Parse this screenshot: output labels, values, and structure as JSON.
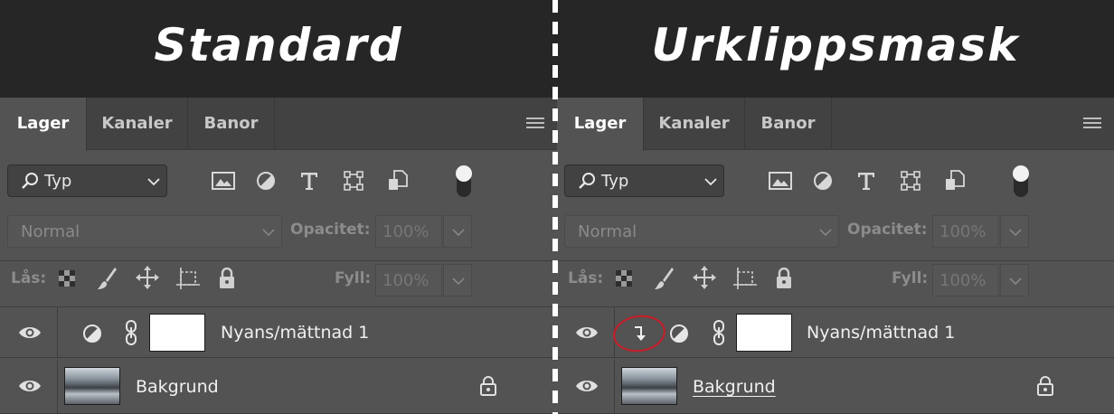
{
  "panels": [
    {
      "heading": "Standard",
      "tabs": [
        "Lager",
        "Kanaler",
        "Banor"
      ],
      "filter_value": "Typ",
      "blend_mode": "Normal",
      "opacity_label": "Opacitet:",
      "opacity_value": "100%",
      "lock_label": "Lås:",
      "fill_label": "Fyll:",
      "fill_value": "100%",
      "layers": [
        {
          "name": "Nyans/mättnad 1",
          "type": "adjustment",
          "clipped": false
        },
        {
          "name": "Bakgrund",
          "type": "image",
          "locked": true
        }
      ]
    },
    {
      "heading": "Urklippsmask",
      "tabs": [
        "Lager",
        "Kanaler",
        "Banor"
      ],
      "filter_value": "Typ",
      "blend_mode": "Normal",
      "opacity_label": "Opacitet:",
      "opacity_value": "100%",
      "lock_label": "Lås:",
      "fill_label": "Fyll:",
      "fill_value": "100%",
      "layers": [
        {
          "name": "Nyans/mättnad 1",
          "type": "adjustment",
          "clipped": true
        },
        {
          "name": "Bakgrund",
          "type": "image",
          "locked": true,
          "underlined": true
        }
      ]
    }
  ],
  "colors": {
    "highlight_circle": "#c0202a",
    "panel_bg": "#535353",
    "tab_bar": "#424242"
  }
}
